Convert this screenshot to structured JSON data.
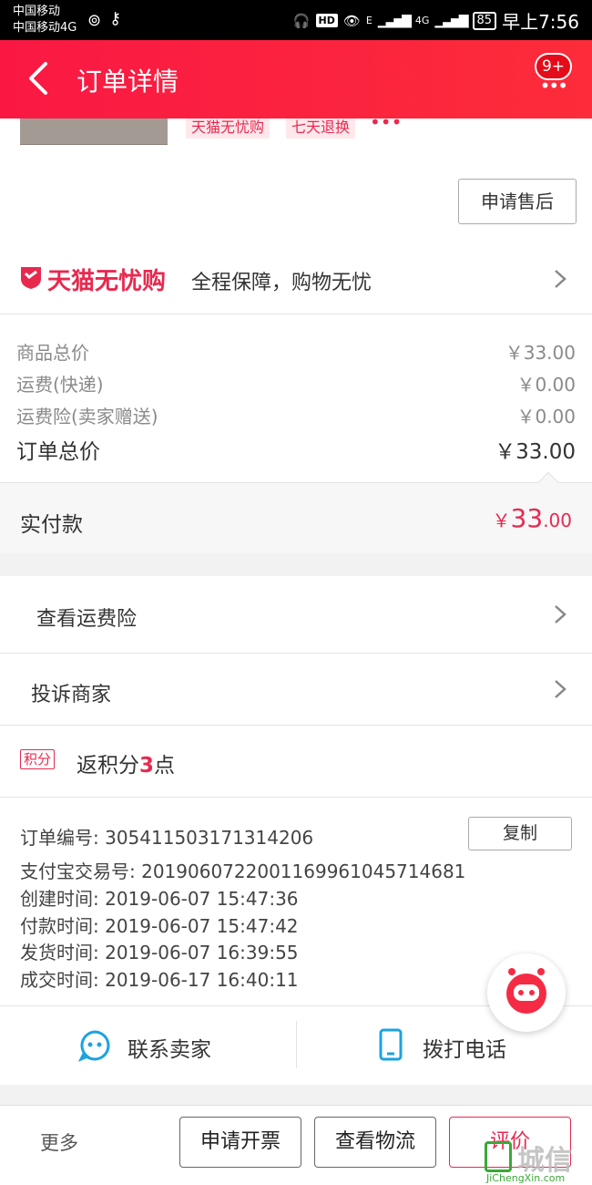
{
  "status_bar": {
    "carrier1": "中国移动",
    "carrier2": "中国移动4G",
    "hd": "HD",
    "net_e": "E",
    "net_4g": "4G",
    "battery": "85",
    "time": "早上7:56"
  },
  "header": {
    "title": "订单详情",
    "badge": "9+",
    "more": "•••"
  },
  "product": {
    "tags": [
      "天猫无忧购",
      "七天退换"
    ],
    "tag_more": "•••",
    "after_sale_button": "申请售后"
  },
  "guarantee": {
    "brand": "天猫无忧购",
    "slogan": "全程保障，购物无忧"
  },
  "prices": {
    "goods_label": "商品总价",
    "goods_value": "￥33.00",
    "shipping_label": "运费(快递)",
    "shipping_value": "￥0.00",
    "insurance_label": "运费险(卖家赠送)",
    "insurance_value": "￥0.00",
    "total_label": "订单总价",
    "total_value": "￥33.00"
  },
  "paid": {
    "label": "实付款",
    "currency": "￥",
    "int": "33",
    "dec": ".00"
  },
  "menu": {
    "insurance": "查看运费险",
    "complain": "投诉商家"
  },
  "points": {
    "badge": "积分",
    "prefix": "返积分",
    "value": "3",
    "suffix": "点"
  },
  "order_info": {
    "order_no_label": "订单编号:",
    "order_no": "305411503171314206",
    "copy_button": "复制",
    "alipay_label": "支付宝交易号:",
    "alipay_no": "2019060722001169961045714681",
    "created_label": "创建时间:",
    "created": "2019-06-07 15:47:36",
    "paid_label": "付款时间:",
    "paid": "2019-06-07 15:47:42",
    "shipped_label": "发货时间:",
    "shipped": "2019-06-07 16:39:55",
    "done_label": "成交时间:",
    "done": "2019-06-17 16:40:11"
  },
  "contact": {
    "seller": "联系卖家",
    "phone": "拨打电话"
  },
  "footer": {
    "more": "更多",
    "invoice": "申请开票",
    "logistics": "查看物流",
    "review": "评价"
  },
  "watermark": {
    "brand": "城信",
    "url": "JiChengXin.com"
  },
  "colors": {
    "header": "#fa1843",
    "accent": "#e8294f",
    "contact_icon": "#1ba3e0"
  },
  "icons": {
    "back": "chevron-left-icon",
    "more": "more-dots-icon",
    "chevron": "chevron-right-icon",
    "chat": "chat-face-icon",
    "phone": "phone-icon",
    "float": "tmall-assistant-icon"
  }
}
